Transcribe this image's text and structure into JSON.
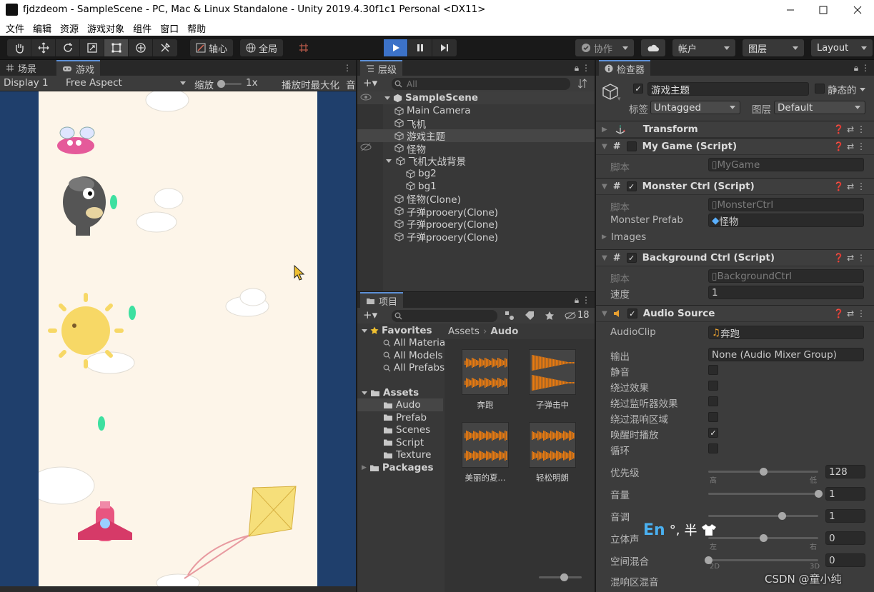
{
  "window": {
    "title": "fjdzdeom - SampleScene - PC, Mac & Linux Standalone - Unity 2019.4.30f1c1 Personal <DX11>"
  },
  "menu": [
    "文件",
    "编辑",
    "资源",
    "游戏对象",
    "组件",
    "窗口",
    "帮助"
  ],
  "toolbar": {
    "pivot_label": "轴心",
    "global_label": "全局",
    "collab_label": "协作",
    "account_label": "帐户",
    "layers_label": "图层",
    "layout_label": "Layout"
  },
  "scene_tab": "场景",
  "game_tab": "游戏",
  "game_view": {
    "display": "Display 1",
    "aspect": "Free Aspect",
    "scale_label": "缩放",
    "scale_value": "1x",
    "maximize_label": "播放时最大化",
    "mute_label": "音"
  },
  "hierarchy": {
    "tab": "层级",
    "search_placeholder": "All",
    "scene": "SampleScene",
    "items": [
      {
        "label": "Main Camera",
        "level": 1
      },
      {
        "label": "飞机",
        "level": 1
      },
      {
        "label": "游戏主题",
        "level": 1,
        "selected": true
      },
      {
        "label": "怪物",
        "level": 1
      },
      {
        "label": "飞机大战背景",
        "level": 1,
        "expanded": true
      },
      {
        "label": "bg2",
        "level": 2
      },
      {
        "label": "bg1",
        "level": 2
      },
      {
        "label": "怪物(Clone)",
        "level": 1
      },
      {
        "label": "子弹prooery(Clone)",
        "level": 1
      },
      {
        "label": "子弹prooery(Clone)",
        "level": 1
      },
      {
        "label": "子弹prooery(Clone)",
        "level": 1
      }
    ]
  },
  "project": {
    "tab": "项目",
    "hidden_count": "18",
    "favorites": {
      "label": "Favorites",
      "items": [
        "All Materia",
        "All Models",
        "All Prefabs"
      ]
    },
    "assets": {
      "label": "Assets",
      "items": [
        "Audo",
        "Prefab",
        "Scenes",
        "Script",
        "Texture"
      ]
    },
    "packages": "Packages",
    "breadcrumb": [
      "Assets",
      "Audo"
    ],
    "files": [
      "奔跑",
      "子弹击中",
      "美丽的夏...",
      "轻松明朗"
    ]
  },
  "inspector": {
    "tab": "检查器",
    "object_name": "游戏主题",
    "static_label": "静态的",
    "tag_label": "标签",
    "tag_value": "Untagged",
    "layer_label": "图层",
    "layer_value": "Default",
    "transform": "Transform",
    "my_game": {
      "title": "My Game (Script)",
      "script_label": "脚本",
      "script_value": "MyGame"
    },
    "monster_ctrl": {
      "title": "Monster Ctrl (Script)",
      "script_label": "脚本",
      "script_value": "MonsterCtrl",
      "prefab_label": "Monster Prefab",
      "prefab_value": "怪物",
      "images_label": "Images"
    },
    "background_ctrl": {
      "title": "Background Ctrl (Script)",
      "script_label": "脚本",
      "script_value": "BackgroundCtrl",
      "speed_label": "速度",
      "speed_value": "1"
    },
    "audio_source": {
      "title": "Audio Source",
      "clip_label": "AudioClip",
      "clip_value": "奔跑",
      "output_label": "输出",
      "output_value": "None (Audio Mixer Group)",
      "toggles": [
        {
          "label": "静音",
          "checked": false
        },
        {
          "label": "绕过效果",
          "checked": false
        },
        {
          "label": "绕过监听器效果",
          "checked": false
        },
        {
          "label": "绕过混响区域",
          "checked": false
        },
        {
          "label": "唤醒时播放",
          "checked": true
        },
        {
          "label": "循环",
          "checked": false
        }
      ],
      "priority": {
        "label": "优先级",
        "value": "128",
        "fraction": 0.5,
        "min_label": "高",
        "max_label": "低"
      },
      "volume": {
        "label": "音量",
        "value": "1",
        "fraction": 1.0
      },
      "pitch": {
        "label": "音调",
        "value": "1",
        "fraction": 0.67
      },
      "stereo_pan": {
        "label": "立体声",
        "value": "0",
        "fraction": 0.5,
        "min_label": "左",
        "max_label": "右"
      },
      "spatial_blend": {
        "label": "空间混合",
        "value": "0",
        "fraction": 0.0,
        "min_label": "2D",
        "max_label": "3D"
      },
      "reverb_mix": {
        "label": "混响区混音"
      }
    }
  },
  "ime": {
    "lang": "En",
    "punct": "°,",
    "width": "半"
  },
  "watermark": "CSDN @童小纯"
}
